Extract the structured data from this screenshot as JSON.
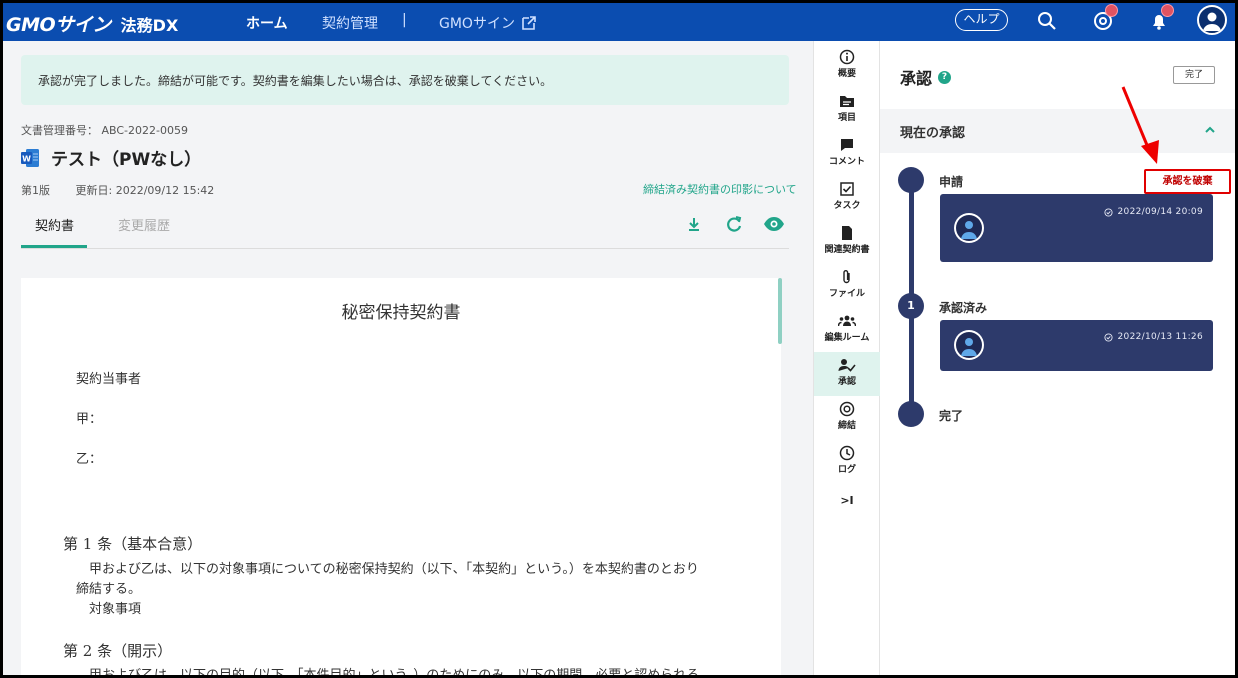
{
  "header": {
    "logo": "GMOサイン",
    "logo_sub": "法務DX",
    "nav_home": "ホーム",
    "nav_contracts": "契約管理",
    "nav_separator": "|",
    "nav_gmo": "GMOサイン",
    "help": "ヘルプ"
  },
  "notice": "承認が完了しました。締結が可能です。契約書を編集したい場合は、承認を破棄してください。",
  "document": {
    "number_label": "文書管理番号：",
    "number": "ABC-2022-0059",
    "title": "テスト（PWなし）",
    "version": "第1版",
    "updated": "更新日: 2022/09/12 15:42",
    "seal_link": "締結済み契約書の印影について"
  },
  "tabs": {
    "contract": "契約書",
    "history": "変更履歴"
  },
  "paper": {
    "title": "秘密保持契約書",
    "parties": "契約当事者",
    "party_a": "甲：",
    "party_b": "乙：",
    "art1_head": "第 1 条（基本合意）",
    "art1_text1": "甲および乙は、以下の対象事項についての秘密保持契約（以下、「本契約」という。）を本契約書のとおり",
    "art1_text2": "締結する。",
    "art1_text3": "対象事項",
    "art2_head": "第 2 条（開示）",
    "art2_text1": "甲および乙は、以下の目的（以下、「本件目的」という。）のためにのみ、以下の期間、必要と認められる"
  },
  "rail": {
    "items": [
      {
        "label": "概要",
        "icon": "info-icon"
      },
      {
        "label": "項目",
        "icon": "folder-icon"
      },
      {
        "label": "コメント",
        "icon": "comment-icon"
      },
      {
        "label": "タスク",
        "icon": "task-icon"
      },
      {
        "label": "関連契約書",
        "icon": "document-icon"
      },
      {
        "label": "ファイル",
        "icon": "paperclip-icon"
      },
      {
        "label": "編集ルーム",
        "icon": "group-icon"
      },
      {
        "label": "承認",
        "icon": "approval-icon"
      },
      {
        "label": "締結",
        "icon": "target-icon"
      },
      {
        "label": "ログ",
        "icon": "clock-icon"
      }
    ],
    "collapse": ">I",
    "active_index": 7
  },
  "approval": {
    "title": "承認",
    "help": "?",
    "done_button": "完了",
    "section_title": "現在の承認",
    "revoke_button": "承認を破棄",
    "steps": [
      {
        "label": "申請",
        "marker": "",
        "time": "2022/09/14 20:09"
      },
      {
        "label": "承認済み",
        "marker": "1",
        "time": "2022/10/13 11:26"
      },
      {
        "label": "完了",
        "marker": ""
      }
    ]
  },
  "colors": {
    "header_bg": "#0b4db0",
    "accent": "#21a58a",
    "timeline": "#2d3a6b",
    "highlight": "#e00000"
  }
}
